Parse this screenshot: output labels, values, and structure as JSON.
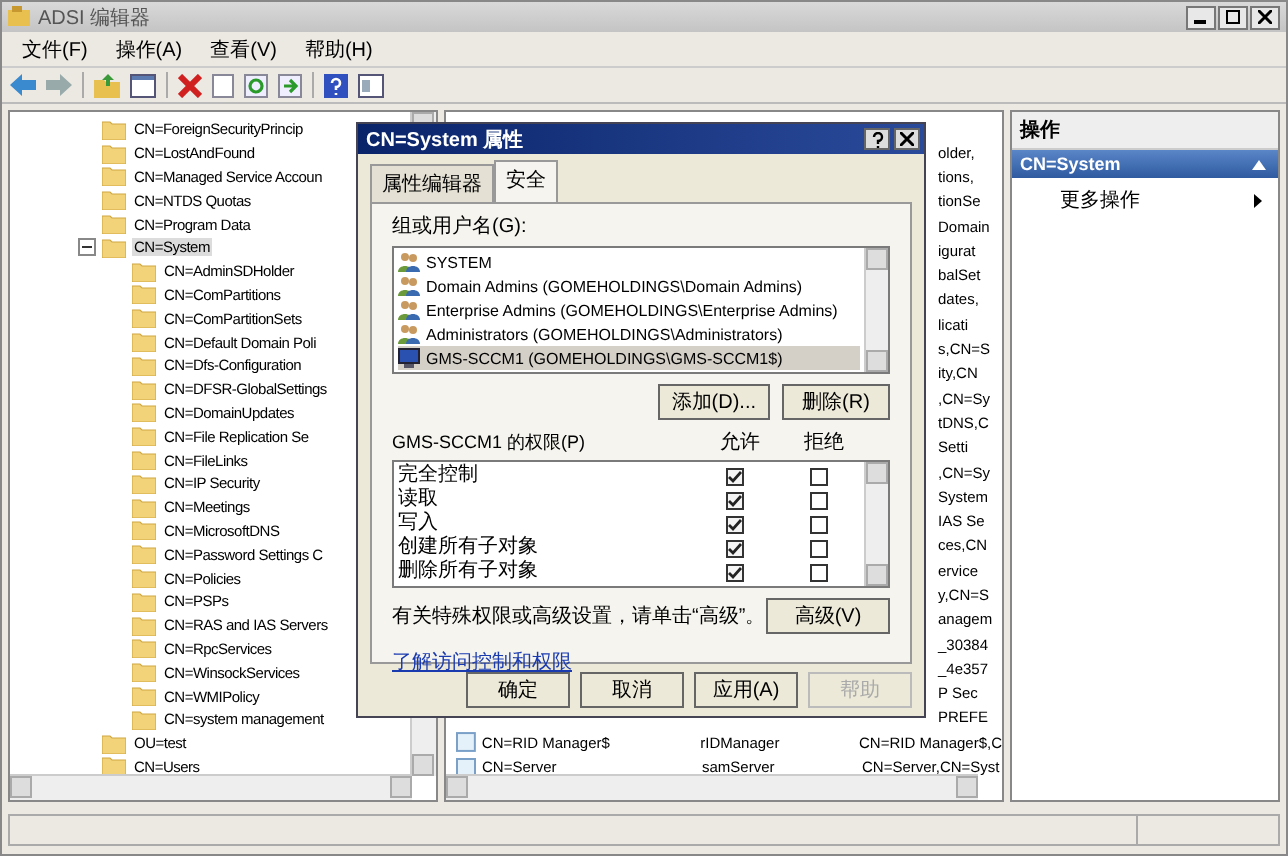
{
  "window": {
    "title": "ADSI 编辑器"
  },
  "menu": [
    "文件(F)",
    "操作(A)",
    "查看(V)",
    "帮助(H)"
  ],
  "tree": {
    "items": [
      {
        "label": "CN=ForeignSecurityPrincip"
      },
      {
        "label": "CN=LostAndFound"
      },
      {
        "label": "CN=Managed Service Accoun"
      },
      {
        "label": "CN=NTDS Quotas"
      },
      {
        "label": "CN=Program Data"
      },
      {
        "label": "CN=System",
        "expanded": true,
        "selected": true,
        "children": [
          {
            "label": "CN=AdminSDHolder"
          },
          {
            "label": "CN=ComPartitions"
          },
          {
            "label": "CN=ComPartitionSets"
          },
          {
            "label": "CN=Default Domain Poli"
          },
          {
            "label": "CN=Dfs-Configuration"
          },
          {
            "label": "CN=DFSR-GlobalSettings"
          },
          {
            "label": "CN=DomainUpdates"
          },
          {
            "label": "CN=File Replication Se"
          },
          {
            "label": "CN=FileLinks"
          },
          {
            "label": "CN=IP Security"
          },
          {
            "label": "CN=Meetings"
          },
          {
            "label": "CN=MicrosoftDNS"
          },
          {
            "label": "CN=Password Settings C"
          },
          {
            "label": "CN=Policies"
          },
          {
            "label": "CN=PSPs"
          },
          {
            "label": "CN=RAS and IAS Servers"
          },
          {
            "label": "CN=RpcServices"
          },
          {
            "label": "CN=WinsockServices"
          },
          {
            "label": "CN=WMIPolicy"
          },
          {
            "label": "CN=system management"
          }
        ]
      },
      {
        "label": "OU=test"
      },
      {
        "label": "CN=Users"
      }
    ]
  },
  "list": {
    "rows": [
      {
        "column_3": "older,"
      },
      {
        "column_3": "tions,"
      },
      {
        "column_3": "tionSe"
      },
      {
        "column_3": "Domain"
      },
      {
        "column_3": "igurat"
      },
      {
        "column_3": "balSet"
      },
      {
        "column_3": "dates,"
      },
      {
        "column_3": "licati"
      },
      {
        "column_3": "s,CN=S"
      },
      {
        "column_3": "ity,CN"
      },
      {
        "column_3": ",CN=Sy"
      },
      {
        "column_3": "tDNS,C"
      },
      {
        "column_3": "Setti"
      },
      {
        "column_3": ",CN=Sy"
      },
      {
        "column_3": "System"
      },
      {
        "column_3": "IAS Se"
      },
      {
        "column_3": "ces,CN"
      },
      {
        "column_3": "ervice"
      },
      {
        "column_3": "y,CN=S"
      },
      {
        "column_3": "anagem"
      },
      {
        "column_3": "_30384"
      },
      {
        "column_3": "_4e357"
      },
      {
        "column_3": "P Sec"
      },
      {
        "column_3": "PREFE"
      },
      {
        "column_1": "CN=RID Manager$",
        "column_2": "rIDManager",
        "column_3": "CN=RID Manager$,C"
      },
      {
        "column_1": "CN=Server",
        "column_2": "samServer",
        "column_3": "CN=Server,CN=Syst"
      }
    ]
  },
  "actions": {
    "title": "操作",
    "section": "CN=System",
    "items": [
      "更多操作"
    ]
  },
  "dialog": {
    "title": "CN=System 属性",
    "tabs": [
      {
        "label": "属性编辑器",
        "selected": false
      },
      {
        "label": "安全",
        "selected": true
      }
    ],
    "users_label": "组或用户名(G):",
    "users": [
      {
        "kind": "group",
        "name": "SYSTEM",
        "selected": false
      },
      {
        "kind": "group",
        "name": "Domain Admins (GOMEHOLDINGS\\Domain Admins)",
        "selected": false
      },
      {
        "kind": "group",
        "name": "Enterprise Admins (GOMEHOLDINGS\\Enterprise Admins)",
        "selected": false
      },
      {
        "kind": "group",
        "name": "Administrators (GOMEHOLDINGS\\Administrators)",
        "selected": false
      },
      {
        "kind": "computer",
        "name": "GMS-SCCM1 (GOMEHOLDINGS\\GMS-SCCM1$)",
        "selected": true
      }
    ],
    "user_buttons": [
      "添加(D)...",
      "删除(R)"
    ],
    "permissions_label": "GMS-SCCM1 的权限(P)",
    "allow_header": "允许",
    "deny_header": "拒绝",
    "permissions": [
      {
        "name": "完全控制",
        "allow": true,
        "deny": false
      },
      {
        "name": "读取",
        "allow": true,
        "deny": false
      },
      {
        "name": "写入",
        "allow": true,
        "deny": false
      },
      {
        "name": "创建所有子对象",
        "allow": true,
        "deny": false
      },
      {
        "name": "删除所有子对象",
        "allow": true,
        "deny": false
      }
    ],
    "advanced_note": "有关特殊权限或高级设置，请单击“高级”。",
    "advanced_button": "高级(V)",
    "link": "了解访问控制和权限",
    "buttons": [
      {
        "label": "确定",
        "disabled": false
      },
      {
        "label": "取消",
        "disabled": false
      },
      {
        "label": "应用(A)",
        "disabled": false
      },
      {
        "label": "帮助",
        "disabled": true
      }
    ]
  }
}
